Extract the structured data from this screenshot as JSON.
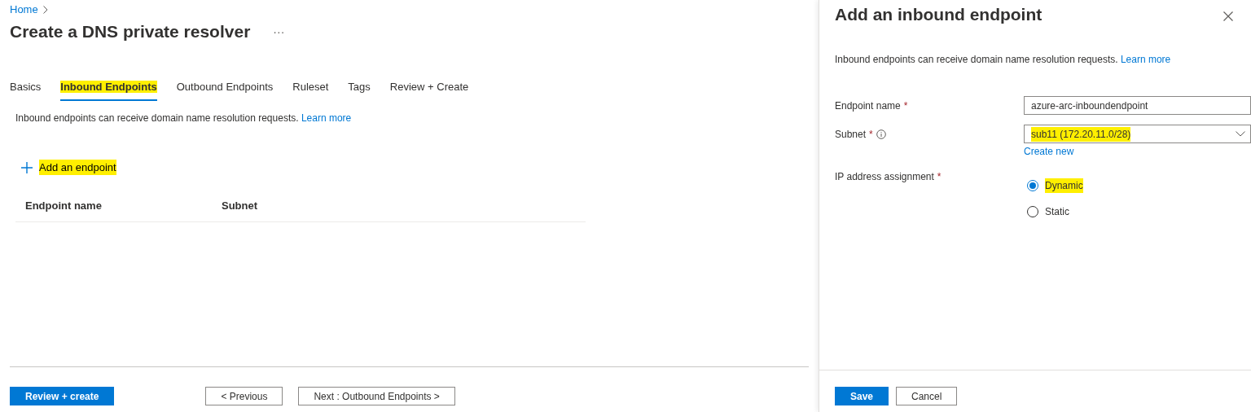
{
  "breadcrumb": [
    "Home"
  ],
  "page_title": "Create a DNS private resolver",
  "more_label": "···",
  "tabs": [
    {
      "label": "Basics",
      "selected": false,
      "highlighted": false
    },
    {
      "label": "Inbound Endpoints",
      "selected": true,
      "highlighted": true
    },
    {
      "label": "Outbound Endpoints",
      "selected": false,
      "highlighted": false
    },
    {
      "label": "Ruleset",
      "selected": false,
      "highlighted": false
    },
    {
      "label": "Tags",
      "selected": false,
      "highlighted": false
    },
    {
      "label": "Review + Create",
      "selected": false,
      "highlighted": false
    }
  ],
  "description": {
    "text": "Inbound endpoints can receive domain name resolution requests.",
    "link": "Learn more"
  },
  "add_button": {
    "label": "Add an endpoint",
    "highlighted": true
  },
  "table": {
    "columns": [
      "Endpoint name",
      "Subnet"
    ]
  },
  "footer_buttons": [
    {
      "label": "Review + create",
      "kind": "primary"
    },
    {
      "label": "< Previous",
      "kind": "secondary"
    },
    {
      "label": "Next : Outbound Endpoints >",
      "kind": "secondary"
    }
  ],
  "panel": {
    "title": "Add an inbound endpoint",
    "description": {
      "text": "Inbound endpoints can receive domain name resolution requests.",
      "link": "Learn more"
    },
    "fields": [
      {
        "kind": "text",
        "label": "Endpoint name",
        "required_mark": "*",
        "info": false,
        "value": "azure-arc-inboundendpoint"
      },
      {
        "kind": "select",
        "label": "Subnet",
        "required_mark": "*",
        "info": true,
        "value": "sub11 (172.20.11.0/28)",
        "highlighted": true,
        "link": "Create new"
      },
      {
        "kind": "radio",
        "label": "IP address assignment",
        "required_mark": "*",
        "info": false,
        "options": [
          {
            "label": "Dynamic",
            "selected": true,
            "highlighted": true
          },
          {
            "label": "Static",
            "selected": false,
            "highlighted": false
          }
        ]
      }
    ],
    "buttons": [
      {
        "label": "Save",
        "kind": "primary"
      },
      {
        "label": "Cancel",
        "kind": "secondary"
      }
    ]
  }
}
